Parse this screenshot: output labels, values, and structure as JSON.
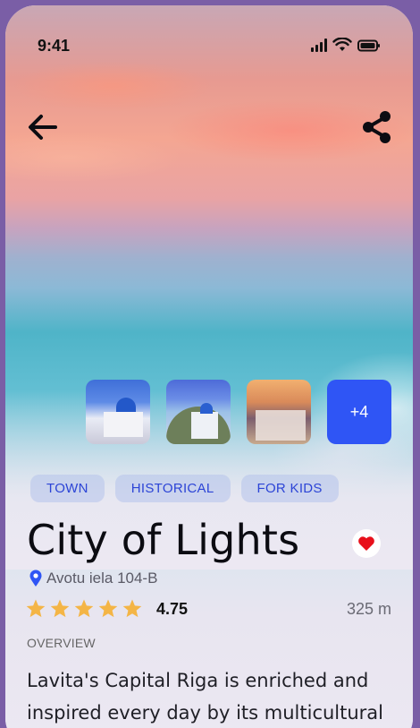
{
  "status_bar": {
    "time": "9:41"
  },
  "gallery": {
    "more_label": "+4"
  },
  "tags": [
    "TOWN",
    "HISTORICAL",
    "FOR KIDS"
  ],
  "place": {
    "title": "City of Lights",
    "address": "Avotu iela 104-B",
    "rating_value": "4.75",
    "rating_stars": 5,
    "distance": "325 m",
    "favorited": true
  },
  "overview": {
    "label": "OVERVIEW",
    "text": "Lavita's Capital Riga is enriched and inspired every day by its multicultural"
  },
  "colors": {
    "accent": "#2f55f5",
    "tag_text": "#2c44d6",
    "star": "#f4b546",
    "heart": "#e8101b"
  },
  "icons": {
    "back": "back-arrow-icon",
    "share": "share-icon",
    "favorite": "heart-icon",
    "location": "location-pin-icon",
    "star": "star-icon"
  }
}
